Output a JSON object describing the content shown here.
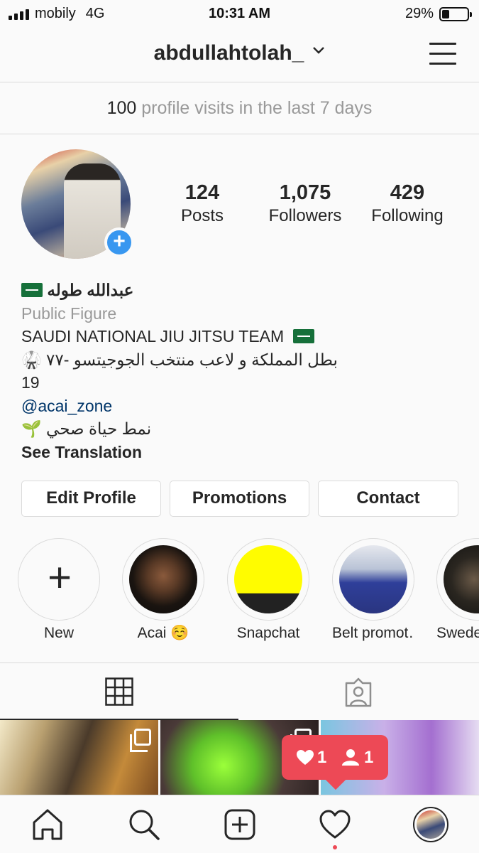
{
  "status_bar": {
    "carrier": "mobily",
    "network": "4G",
    "time": "10:31 AM",
    "battery_percent": "29%",
    "battery_level": 0.29
  },
  "header": {
    "username": "abdullahtolah_"
  },
  "visits": {
    "count": "100",
    "text": "profile visits in the last 7 days"
  },
  "stats": {
    "posts": {
      "value": "124",
      "label": "Posts"
    },
    "followers": {
      "value": "1,075",
      "label": "Followers"
    },
    "following": {
      "value": "429",
      "label": "Following"
    }
  },
  "bio": {
    "name": "عبدالله طوله",
    "category": "Public Figure",
    "line1": "SAUDI NATIONAL JIU JITSU TEAM",
    "line2": "بطل المملكة و لاعب منتخب الجوجيتسو -٧٧",
    "line2_emoji": "🥋",
    "line3": "19",
    "mention": "@acai_zone",
    "line5": "نمط حياة صحي",
    "line5_emoji": "🌱",
    "see_translation": "See Translation"
  },
  "buttons": {
    "edit_profile": "Edit Profile",
    "promotions": "Promotions",
    "contact": "Contact"
  },
  "highlights": [
    {
      "label": "New",
      "icon": "plus-icon"
    },
    {
      "label": "Acai ☺️"
    },
    {
      "label": "Snapchat"
    },
    {
      "label": "Belt promot…"
    },
    {
      "label": "Swede"
    }
  ],
  "notifications": {
    "likes": "1",
    "follows": "1"
  },
  "colors": {
    "accent": "#3897f0",
    "notif": "#ed4956",
    "link": "#003569",
    "flag": "#16703a"
  },
  "icons": [
    "grid-icon",
    "tagged-icon",
    "home-icon",
    "search-icon",
    "add-post-icon",
    "heart-icon",
    "profile-avatar"
  ]
}
